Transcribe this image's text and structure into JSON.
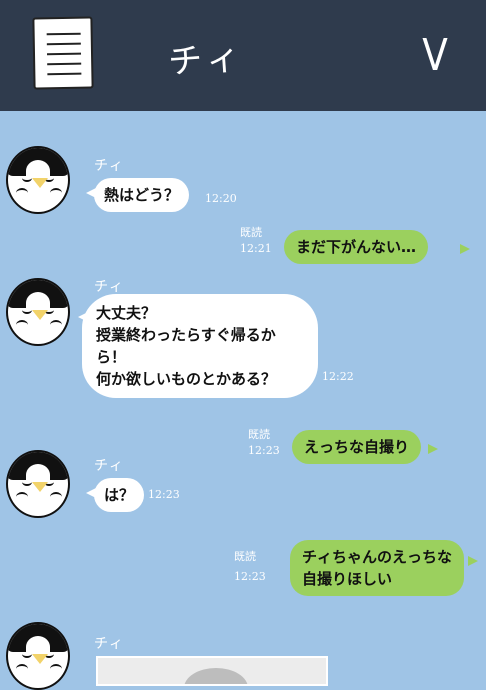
{
  "header": {
    "title": "チィ",
    "menu_icon": "note-list-icon",
    "check_icon": "check-icon",
    "check_glyph": "V"
  },
  "messages": [
    {
      "side": "in",
      "sender": "チィ",
      "text": "熱はどう？",
      "time": "12:20"
    },
    {
      "side": "out",
      "read": "既読",
      "text": "まだ下がんない…",
      "time": "12:21"
    },
    {
      "side": "in",
      "sender": "チィ",
      "text": "大丈夫？\n授業終わったらすぐ帰るから！\n何か欲しいものとかある？",
      "time": "12:22"
    },
    {
      "side": "out",
      "read": "既読",
      "text": "えっちな自撮り",
      "time": "12:23"
    },
    {
      "side": "in",
      "sender": "チィ",
      "text": "は？",
      "time": "12:23"
    },
    {
      "side": "out",
      "read": "既読",
      "text": "チィちゃんのえっちな\n自撮りほしい",
      "time": "12:23"
    },
    {
      "side": "in",
      "sender": "チィ",
      "type": "image"
    }
  ],
  "colors": {
    "background": "#9fc4e6",
    "header": "#2f3b4d",
    "incoming_bubble": "#ffffff",
    "outgoing_bubble": "#9bd05e"
  }
}
